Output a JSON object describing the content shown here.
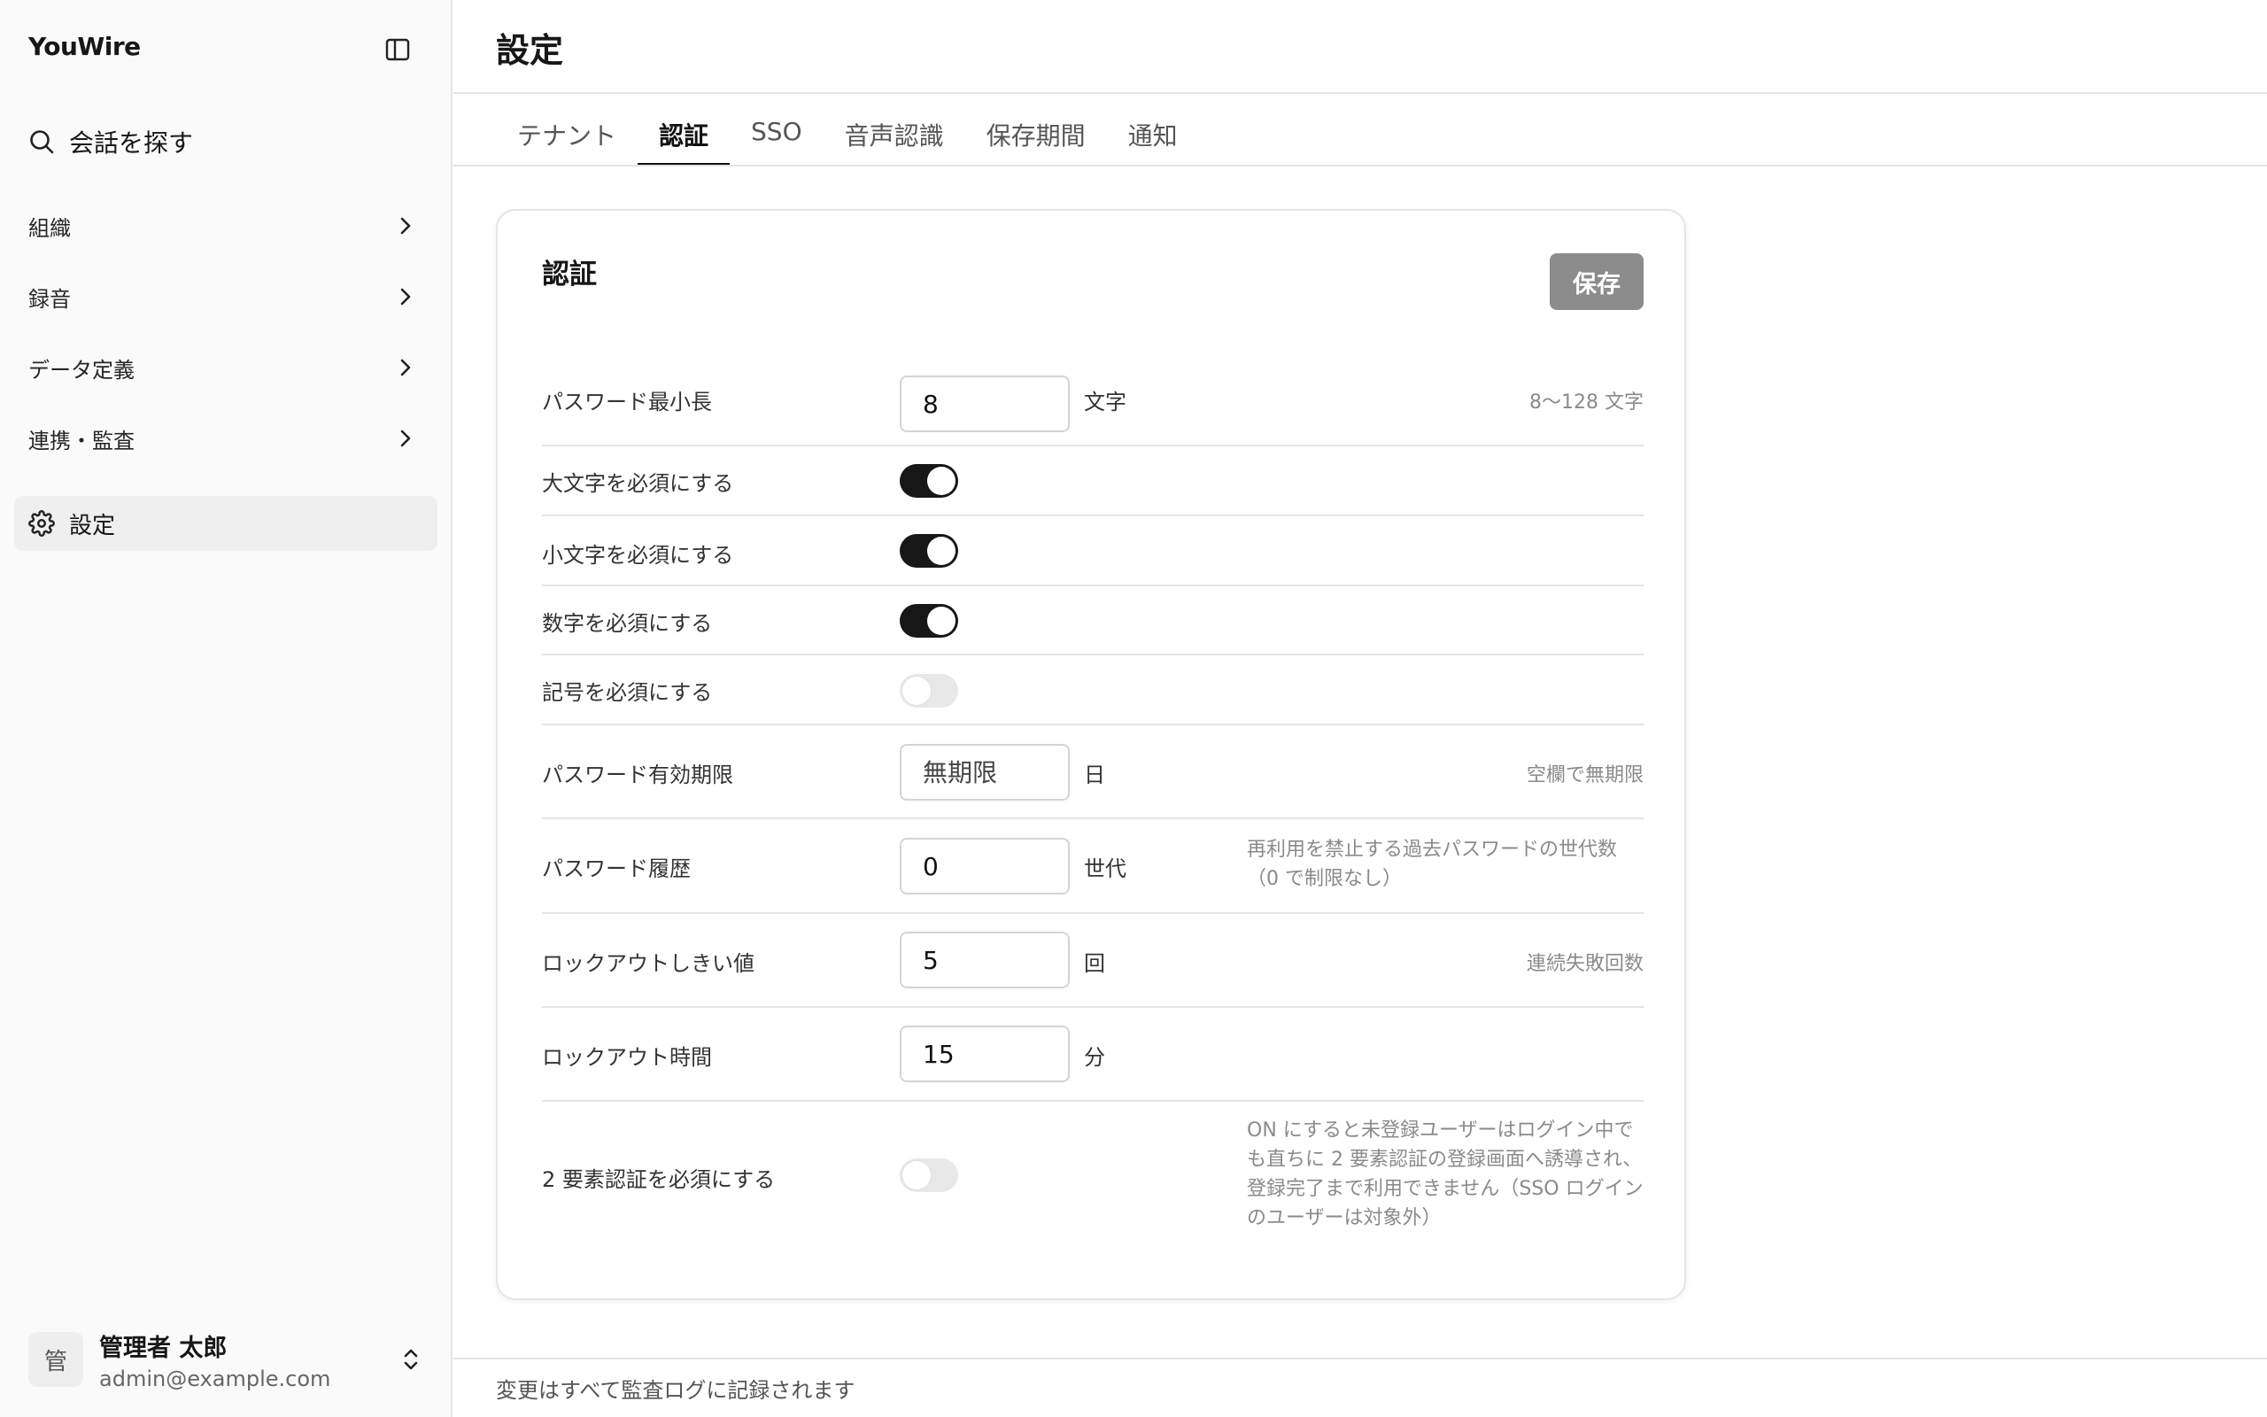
{
  "app": {
    "brand": "YouWire"
  },
  "sidebar": {
    "search_label": "会話を探す",
    "items": [
      {
        "label": "組織"
      },
      {
        "label": "録音"
      },
      {
        "label": "データ定義"
      },
      {
        "label": "連携・監査"
      }
    ],
    "active_item": {
      "label": "設定"
    },
    "user": {
      "avatar_initial": "管",
      "name": "管理者 太郎",
      "email": "admin@example.com"
    }
  },
  "header": {
    "title": "設定"
  },
  "tabs": [
    {
      "label": "テナント",
      "active": false
    },
    {
      "label": "認証",
      "active": true
    },
    {
      "label": "SSO",
      "active": false
    },
    {
      "label": "音声認識",
      "active": false
    },
    {
      "label": "保存期間",
      "active": false
    },
    {
      "label": "通知",
      "active": false
    }
  ],
  "card": {
    "title": "認証",
    "save_label": "保存",
    "rows": {
      "min_length": {
        "label": "パスワード最小長",
        "value": "8",
        "unit": "文字",
        "hint": "8〜128 文字"
      },
      "require_upper": {
        "label": "大文字を必須にする",
        "enabled": true
      },
      "require_lower": {
        "label": "小文字を必須にする",
        "enabled": true
      },
      "require_digit": {
        "label": "数字を必須にする",
        "enabled": true
      },
      "require_symbol": {
        "label": "記号を必須にする",
        "enabled": false
      },
      "expiry": {
        "label": "パスワード有効期限",
        "value": "",
        "placeholder": "無期限",
        "unit": "日",
        "hint": "空欄で無期限"
      },
      "history": {
        "label": "パスワード履歴",
        "value": "0",
        "unit": "世代",
        "hint": "再利用を禁止する過去パスワードの世代数（0 で制限なし）"
      },
      "lockout_threshold": {
        "label": "ロックアウトしきい値",
        "value": "5",
        "unit": "回",
        "hint": "連続失敗回数"
      },
      "lockout_duration": {
        "label": "ロックアウト時間",
        "value": "15",
        "unit": "分"
      },
      "require_2fa": {
        "label": "2 要素認証を必須にする",
        "enabled": false,
        "hint": "ON にすると未登録ユーザーはログイン中でも直ちに 2 要素認証の登録画面へ誘導され、登録完了まで利用できません（SSO ログインのユーザーは対象外）"
      }
    }
  },
  "footer": {
    "text": "変更はすべて監査ログに記録されます"
  },
  "colors": {
    "accent": "#171717",
    "save_button": "#8c8c8c",
    "border": "#e5e5e5",
    "hint": "#8a8a8a"
  }
}
